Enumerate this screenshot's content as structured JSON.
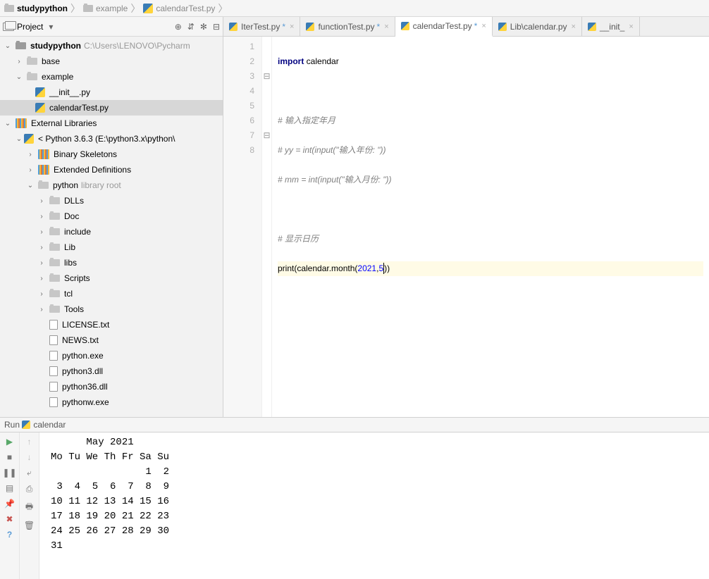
{
  "breadcrumb": {
    "root": "studypython",
    "mid": "example",
    "file": "calendarTest.py"
  },
  "sidebar": {
    "title": "Project",
    "tools": {
      "target": "⊕",
      "collapse": "⇵",
      "gear": "✻",
      "hide": "⊟"
    }
  },
  "tree": [
    {
      "d": 0,
      "exp": "v",
      "icon": "root",
      "label": "studypython",
      "muted": "C:\\Users\\LENOVO\\Pycharm"
    },
    {
      "d": 1,
      "exp": ">",
      "icon": "dir",
      "label": "base"
    },
    {
      "d": 1,
      "exp": "v",
      "icon": "dir",
      "label": "example"
    },
    {
      "d": 2,
      "exp": "",
      "icon": "py",
      "label": "__init__.py"
    },
    {
      "d": 2,
      "exp": "",
      "icon": "py",
      "label": "calendarTest.py",
      "selected": true
    },
    {
      "d": 0,
      "exp": "v",
      "icon": "lib",
      "label": "External Libraries"
    },
    {
      "d": 1,
      "exp": "v",
      "icon": "py",
      "label": "< Python 3.6.3 (E:\\python3.x\\python\\"
    },
    {
      "d": 2,
      "exp": ">",
      "icon": "lib",
      "label": "Binary Skeletons"
    },
    {
      "d": 2,
      "exp": ">",
      "icon": "lib",
      "label": "Extended Definitions"
    },
    {
      "d": 2,
      "exp": "v",
      "icon": "dir",
      "label": "python",
      "muted": "library root"
    },
    {
      "d": 3,
      "exp": ">",
      "icon": "dir",
      "label": "DLLs"
    },
    {
      "d": 3,
      "exp": ">",
      "icon": "dir",
      "label": "Doc"
    },
    {
      "d": 3,
      "exp": ">",
      "icon": "dir",
      "label": "include"
    },
    {
      "d": 3,
      "exp": ">",
      "icon": "dir",
      "label": "Lib"
    },
    {
      "d": 3,
      "exp": ">",
      "icon": "dir",
      "label": "libs"
    },
    {
      "d": 3,
      "exp": ">",
      "icon": "dir",
      "label": "Scripts"
    },
    {
      "d": 3,
      "exp": ">",
      "icon": "dir",
      "label": "tcl"
    },
    {
      "d": 3,
      "exp": ">",
      "icon": "dir",
      "label": "Tools"
    },
    {
      "d": 3,
      "exp": "",
      "icon": "file",
      "label": "LICENSE.txt"
    },
    {
      "d": 3,
      "exp": "",
      "icon": "file",
      "label": "NEWS.txt"
    },
    {
      "d": 3,
      "exp": "",
      "icon": "file",
      "label": "python.exe"
    },
    {
      "d": 3,
      "exp": "",
      "icon": "file",
      "label": "python3.dll"
    },
    {
      "d": 3,
      "exp": "",
      "icon": "file",
      "label": "python36.dll"
    },
    {
      "d": 3,
      "exp": "",
      "icon": "file",
      "label": "pythonw.exe"
    }
  ],
  "tabs": [
    {
      "label": "IterTest.py",
      "dirty": true
    },
    {
      "label": "functionTest.py",
      "dirty": true
    },
    {
      "label": "calendarTest.py",
      "dirty": true,
      "active": true
    },
    {
      "label": "Lib\\calendar.py"
    },
    {
      "label": "__init_"
    }
  ],
  "code": {
    "lines": [
      "1",
      "2",
      "3",
      "4",
      "5",
      "6",
      "7",
      "8"
    ],
    "l1a": "import",
    "l1b": " calendar",
    "l3": "# 输入指定年月",
    "l4": "# yy = int(input(\"输入年份: \"))",
    "l5": "# mm = int(input(\"输入月份: \"))",
    "l7": "# 显示日历",
    "l8a": "print",
    "l8b": "(calendar.month(",
    "l8c": "2021",
    "l8d": ",",
    "l8e": "5",
    "l8f": "))"
  },
  "run": {
    "label": "Run",
    "config": "calendar",
    "output": "      May 2021\nMo Tu We Th Fr Sa Su\n                1  2\n 3  4  5  6  7  8  9\n10 11 12 13 14 15 16\n17 18 19 20 21 22 23\n24 25 26 27 28 29 30\n31"
  }
}
